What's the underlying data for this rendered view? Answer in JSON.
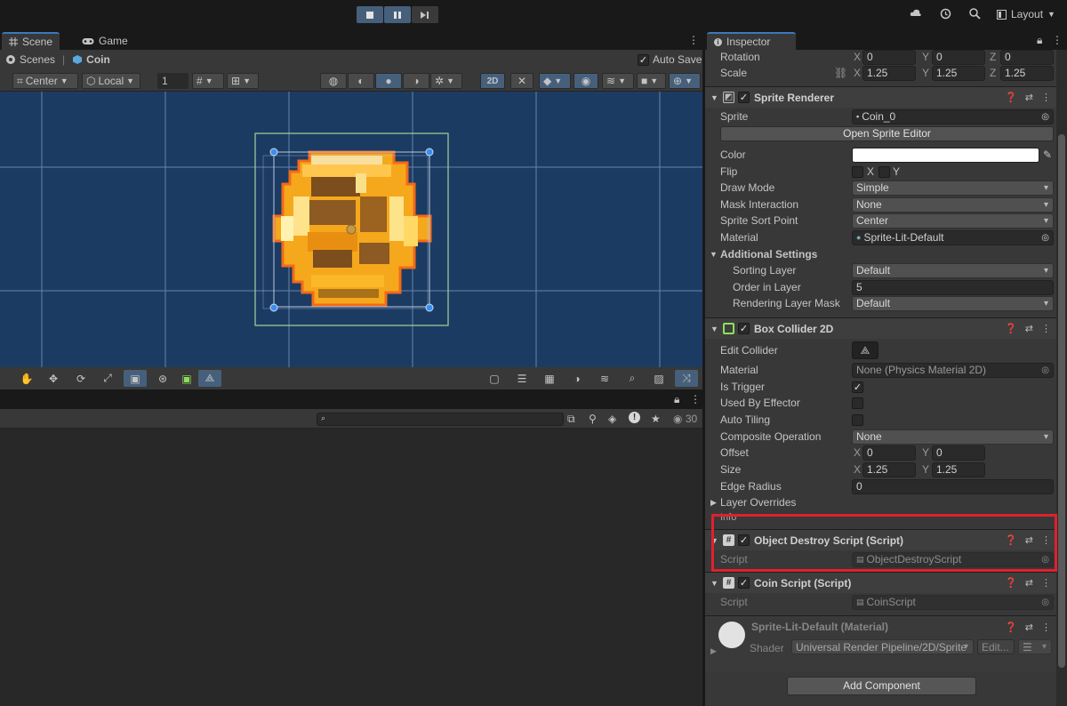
{
  "topbar": {
    "layout_label": "Layout"
  },
  "tabs": {
    "scene": "Scene",
    "game": "Game",
    "inspector": "Inspector"
  },
  "breadcrumb": {
    "scenes": "Scenes",
    "object": "Coin",
    "auto_save": "Auto Save"
  },
  "toolbar": {
    "pivot": "Center",
    "space": "Local",
    "grid_size": "1",
    "mode_2d": "2D"
  },
  "console": {
    "count": "30"
  },
  "transform": {
    "rotation_label": "Rotation",
    "rotation": {
      "x": "0",
      "y": "0",
      "z": "0"
    },
    "scale_label": "Scale",
    "scale": {
      "x": "1.25",
      "y": "1.25",
      "z": "1.25"
    },
    "axis": {
      "x": "X",
      "y": "Y",
      "z": "Z"
    }
  },
  "sprite_renderer": {
    "title": "Sprite Renderer",
    "sprite_label": "Sprite",
    "sprite": "Coin_0",
    "open_editor": "Open Sprite Editor",
    "color_label": "Color",
    "color": "#ffffff",
    "flip_label": "Flip",
    "flip_x": "X",
    "flip_y": "Y",
    "draw_mode_label": "Draw Mode",
    "draw_mode": "Simple",
    "mask_label": "Mask Interaction",
    "mask": "None",
    "sort_point_label": "Sprite Sort Point",
    "sort_point": "Center",
    "material_label": "Material",
    "material": "Sprite-Lit-Default",
    "additional": "Additional Settings",
    "sorting_layer_label": "Sorting Layer",
    "sorting_layer": "Default",
    "order_label": "Order in Layer",
    "order": "5",
    "rlm_label": "Rendering Layer Mask",
    "rlm": "Default"
  },
  "box_collider": {
    "title": "Box Collider 2D",
    "edit_label": "Edit Collider",
    "material_label": "Material",
    "material": "None (Physics Material 2D)",
    "trigger_label": "Is Trigger",
    "effector_label": "Used By Effector",
    "tiling_label": "Auto Tiling",
    "composite_label": "Composite Operation",
    "composite": "None",
    "offset_label": "Offset",
    "offset": {
      "x": "0",
      "y": "0"
    },
    "size_label": "Size",
    "size": {
      "x": "1.25",
      "y": "1.25"
    },
    "edge_label": "Edge Radius",
    "edge": "0",
    "layer_overrides": "Layer Overrides",
    "info": "Info"
  },
  "object_destroy": {
    "title": "Object Destroy Script (Script)",
    "script_label": "Script",
    "script": "ObjectDestroyScript"
  },
  "coin_script": {
    "title": "Coin Script (Script)",
    "script_label": "Script",
    "script": "CoinScript"
  },
  "material_preview": {
    "title": "Sprite-Lit-Default (Material)",
    "shader_label": "Shader",
    "shader": "Universal Render Pipeline/2D/Sprite",
    "edit": "Edit..."
  },
  "add_component": "Add Component",
  "colors": {
    "highlight": "#e0202f",
    "selection": "#46607c",
    "scene_bg": "#1c3b62",
    "coin": "#f5a81c"
  }
}
